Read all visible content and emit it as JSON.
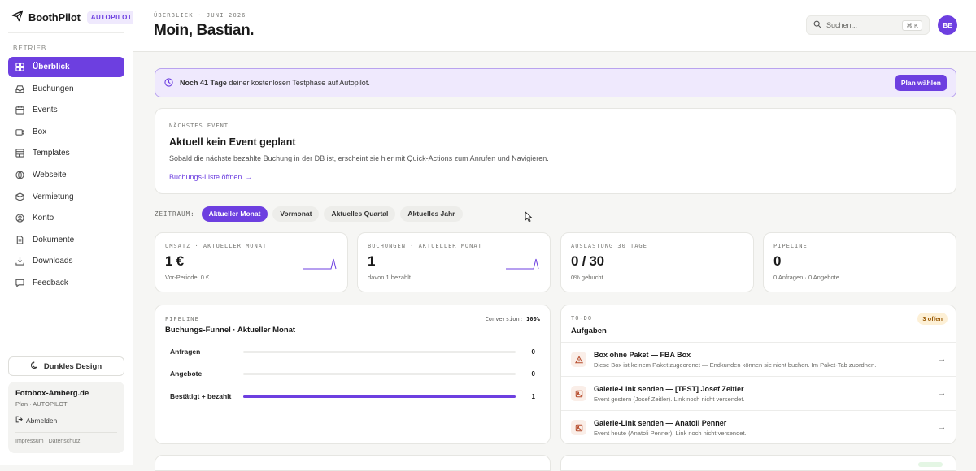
{
  "brand": {
    "name": "BoothPilot",
    "badge": "AUTOPILOT"
  },
  "sidebar": {
    "section": "BETRIEB",
    "items": [
      {
        "label": "Überblick",
        "icon": "grid-icon",
        "active": true
      },
      {
        "label": "Buchungen",
        "icon": "inbox-icon"
      },
      {
        "label": "Events",
        "icon": "calendar-icon"
      },
      {
        "label": "Box",
        "icon": "camera-icon"
      },
      {
        "label": "Templates",
        "icon": "layout-icon"
      },
      {
        "label": "Webseite",
        "icon": "globe-icon"
      },
      {
        "label": "Vermietung",
        "icon": "package-icon"
      },
      {
        "label": "Konto",
        "icon": "user-circle-icon"
      },
      {
        "label": "Dokumente",
        "icon": "document-icon"
      },
      {
        "label": "Downloads",
        "icon": "download-icon"
      },
      {
        "label": "Feedback",
        "icon": "chat-icon"
      }
    ],
    "dark_mode": "Dunkles Design",
    "account": {
      "name": "Fotobox-Amberg.de",
      "plan": "Plan · AUTOPILOT",
      "logout": "Abmelden",
      "links": [
        "Impressum",
        "Datenschutz"
      ]
    }
  },
  "header": {
    "crumb": "ÜBERBLICK · JUNI 2026",
    "greeting": "Moin, Bastian.",
    "search_placeholder": "Suchen...",
    "search_kbd": "⌘ K",
    "avatar": "BE"
  },
  "trial": {
    "bold": "Noch 41 Tage",
    "text": " deiner kostenlosen Testphase auf Autopilot.",
    "button": "Plan wählen"
  },
  "next_event": {
    "eyebrow": "NÄCHSTES EVENT",
    "title": "Aktuell kein Event geplant",
    "desc": "Sobald die nächste bezahlte Buchung in der DB ist, erscheint sie hier mit Quick-Actions zum Anrufen und Navigieren.",
    "link": "Buchungs-Liste öffnen",
    "link_arrow": "→"
  },
  "period": {
    "label": "ZEITRAUM:",
    "options": [
      "Aktueller Monat",
      "Vormonat",
      "Aktuelles Quartal",
      "Aktuelles Jahr"
    ],
    "selected": "Aktueller Monat"
  },
  "kpis": [
    {
      "label": "UMSATZ · AKTUELLER MONAT",
      "value": "1 €",
      "sub": "Vor-Periode: 0 €",
      "spark": true
    },
    {
      "label": "BUCHUNGEN · AKTUELLER MONAT",
      "value": "1",
      "sub": "davon 1 bezahlt",
      "spark": true
    },
    {
      "label": "AUSLASTUNG 30 TAGE",
      "value": "0 / 30",
      "sub": "0% gebucht",
      "spark": false
    },
    {
      "label": "PIPELINE",
      "value": "0",
      "sub": "0 Anfragen · 0 Angebote",
      "spark": false
    }
  ],
  "funnel": {
    "eyebrow": "PIPELINE",
    "title": "Buchungs-Funnel · Aktueller Monat",
    "conversion_label": "Conversion:",
    "conversion_value": "100%",
    "rows": [
      {
        "label": "Anfragen",
        "count": "0",
        "fill": 0
      },
      {
        "label": "Angebote",
        "count": "0",
        "fill": 0
      },
      {
        "label": "Bestätigt + bezahlt",
        "count": "1",
        "fill": 1
      }
    ]
  },
  "tasks": {
    "eyebrow": "TO-DO",
    "title": "Aufgaben",
    "badge": "3 offen",
    "items": [
      {
        "icon": "warning-icon",
        "title": "Box ohne Paket — FBA Box",
        "desc": "Diese Box ist keinem Paket zugeordnet — Endkunden können sie nicht buchen. Im Paket-Tab zuordnen."
      },
      {
        "icon": "image-icon",
        "title": "Galerie-Link senden — [TEST] Josef Zeitler",
        "desc": "Event gestern (Josef Zeitler). Link noch nicht versendet."
      },
      {
        "icon": "image-icon",
        "title": "Galerie-Link senden — Anatoli Penner",
        "desc": "Event heute (Anatoli Penner). Link noch nicht versendet."
      }
    ],
    "arrow": "→"
  },
  "colors": {
    "accent": "#6d3fe0",
    "accent_soft": "#efe9fd",
    "warn_bg": "#fdf0d6"
  }
}
